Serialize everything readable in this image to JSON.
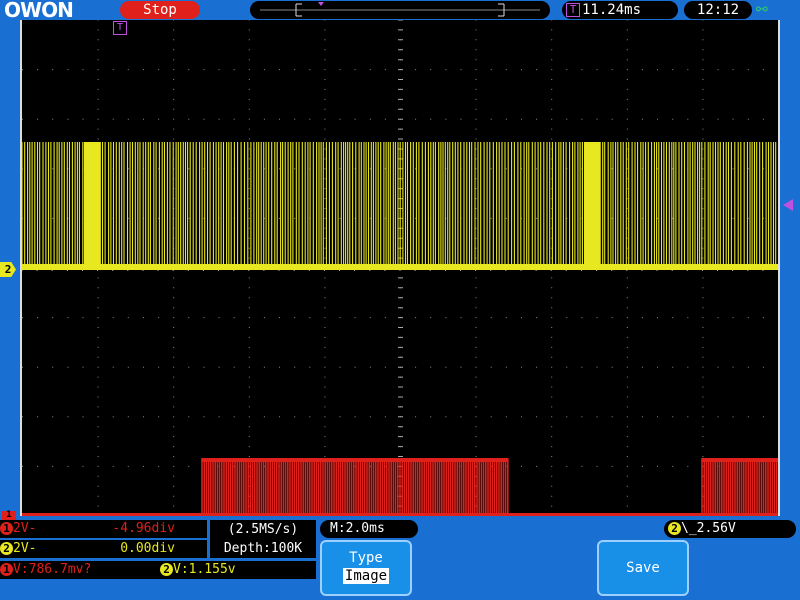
{
  "header": {
    "logo": "OWON",
    "status": "Stop",
    "trigger_time": "11.24ms",
    "clock": "12:12"
  },
  "markers": {
    "trigger_badge": "T",
    "ch2_marker": "2",
    "ch1_marker": "1"
  },
  "ch1": {
    "channel": "1",
    "scale": "2V",
    "coupling": "-",
    "offset": "-4.96div",
    "color": "#e0201a"
  },
  "ch2": {
    "channel": "2",
    "scale": "2V",
    "coupling": "-",
    "offset": "0.00div",
    "color": "#e8e820"
  },
  "acquisition": {
    "sample_rate": "(2.5MS/s)",
    "depth": "Depth:100K"
  },
  "timebase": {
    "main": "M:2.0ms"
  },
  "trigger": {
    "channel": "2",
    "edge": "\\_",
    "level": "2.56V"
  },
  "measurements": {
    "ch1": "V:786.7mv?",
    "ch2": "V:1.155v"
  },
  "buttons": {
    "type_label": "Type",
    "type_value": "Image",
    "save_label": "Save"
  },
  "colors": {
    "background": "#1a6fd3",
    "screen": "#000000",
    "trigger_marker": "#c050e0"
  }
}
